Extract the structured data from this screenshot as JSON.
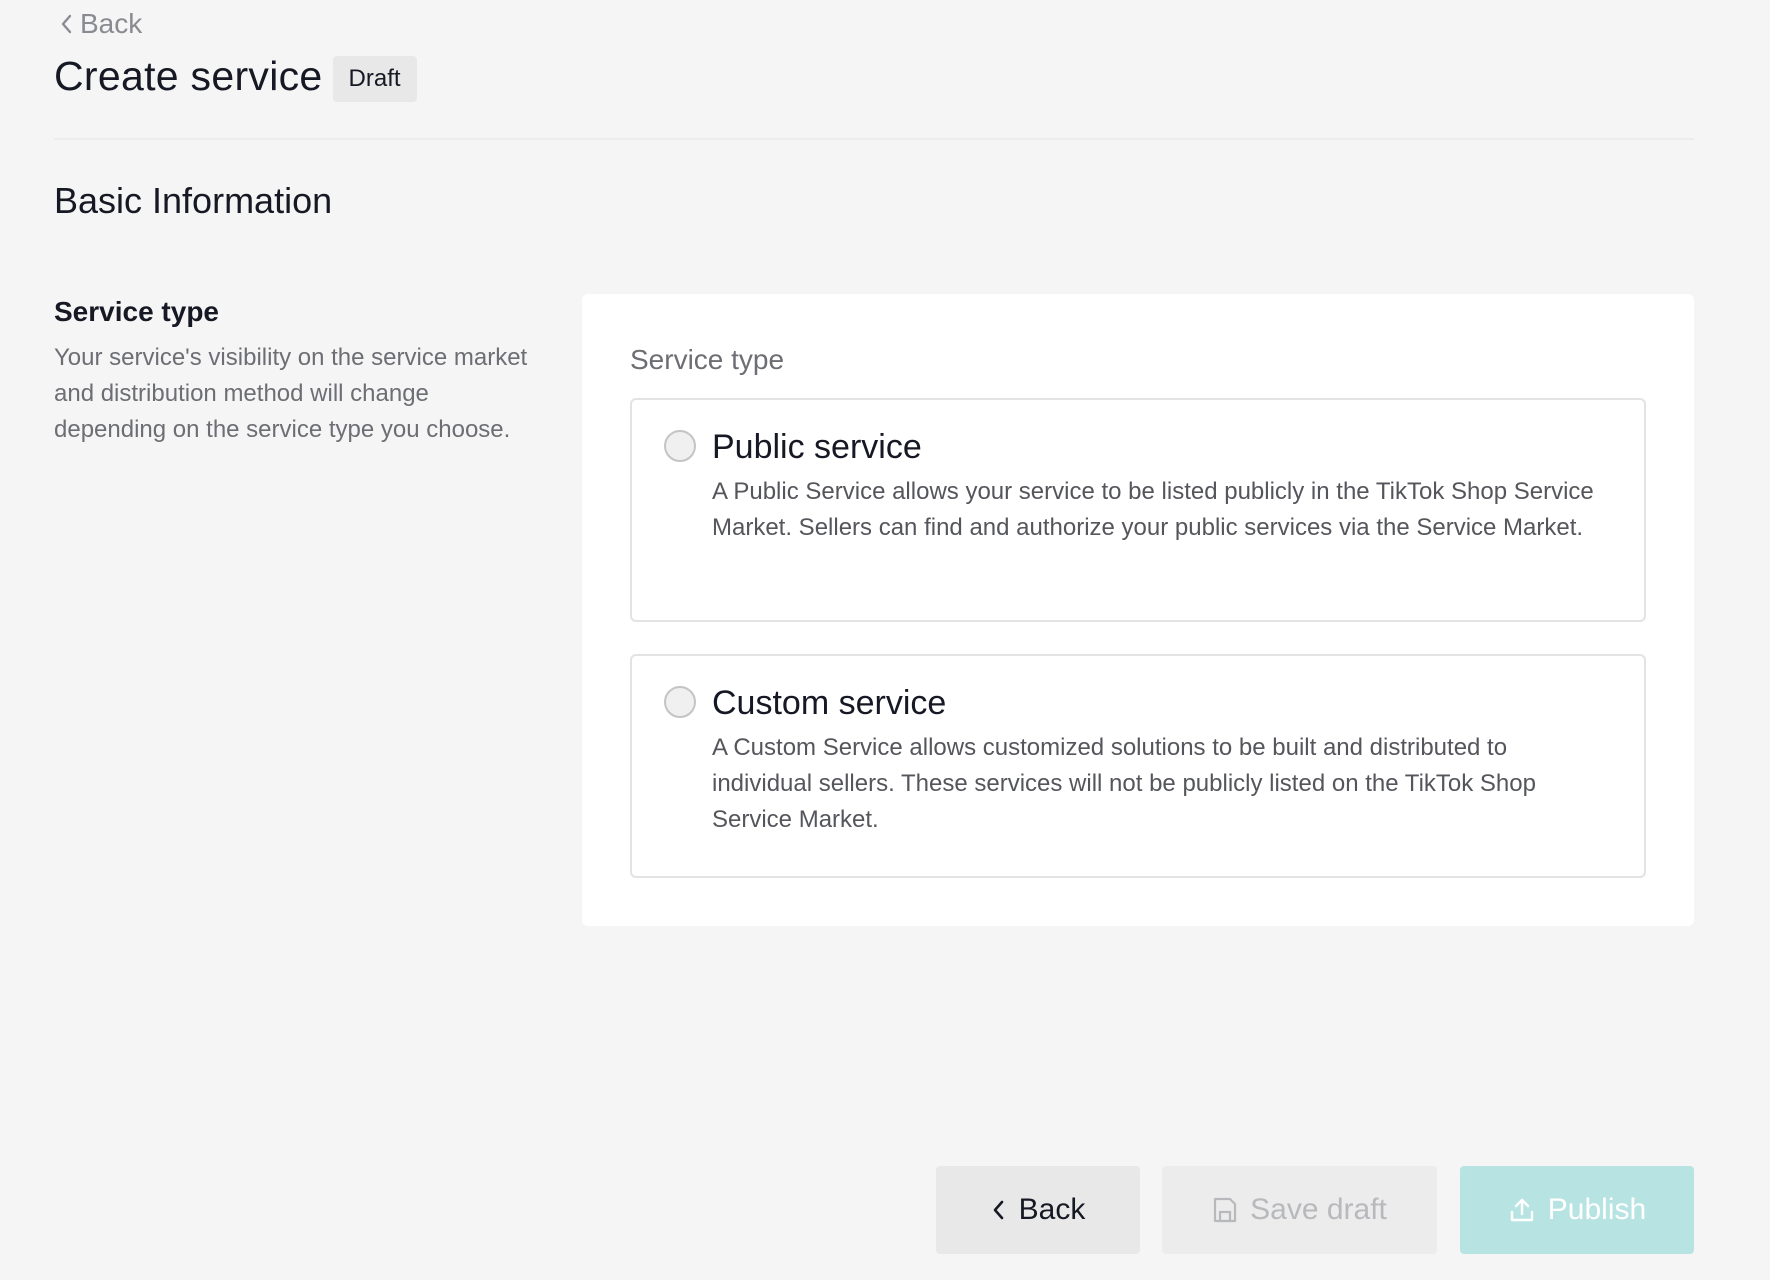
{
  "header": {
    "back_link": "Back",
    "title": "Create service",
    "status_badge": "Draft"
  },
  "section": {
    "title": "Basic Information"
  },
  "service_type_field": {
    "label": "Service type",
    "description": "Your service's visibility on the service market and distribution method will change depending on the service type you choose.",
    "card_label": "Service type",
    "options": [
      {
        "title": "Public service",
        "description": "A Public Service allows your service to be listed publicly in the TikTok Shop Service Market. Sellers can find and authorize your public services via the Service Market.",
        "selected": false
      },
      {
        "title": "Custom service",
        "description": "A Custom Service allows customized solutions to be built and distributed to individual sellers. These services will not be publicly listed on the TikTok Shop Service Market.",
        "selected": false
      }
    ]
  },
  "footer": {
    "back_label": "Back",
    "save_draft_label": "Save draft",
    "publish_label": "Publish"
  },
  "icons": {
    "back": "chevron-left-icon",
    "save_draft": "save-icon",
    "publish": "upload-icon"
  },
  "colors": {
    "publish_disabled": "#b7e4e3",
    "page_background": "#f5f5f5"
  }
}
